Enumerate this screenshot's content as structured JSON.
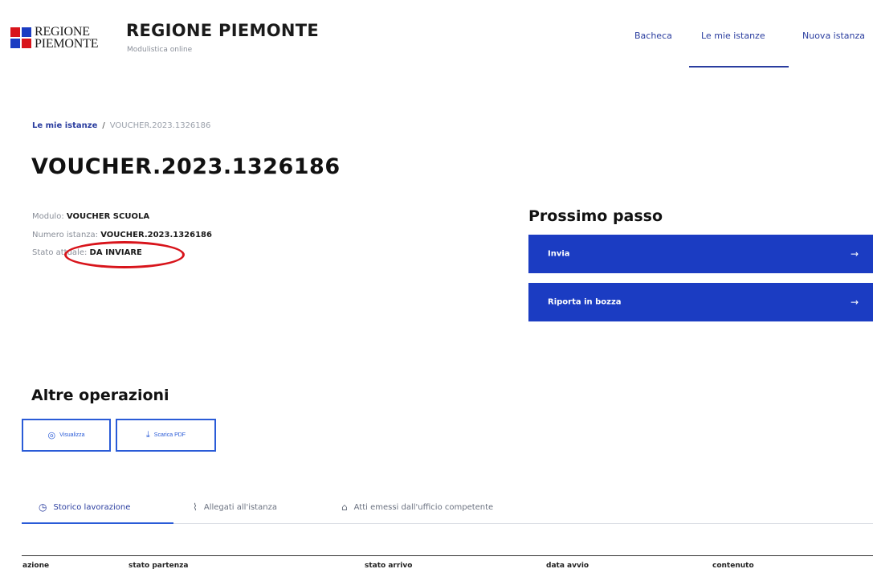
{
  "header": {
    "logo_line1": "REGIONE",
    "logo_line2": "PIEMONTE",
    "title": "REGIONE PIEMONTE",
    "subtitle": "Modulistica online",
    "nav": [
      {
        "label": "Bacheca"
      },
      {
        "label": "Le mie istanze"
      },
      {
        "label": "Nuova istanza"
      }
    ]
  },
  "breadcrumb": {
    "link": "Le mie istanze",
    "separator": "/",
    "current": "VOUCHER.2023.1326186"
  },
  "page_title": "VOUCHER.2023.1326186",
  "info": {
    "modulo_label": "Modulo:",
    "modulo_value": "VOUCHER SCUOLA",
    "numero_label": "Numero istanza:",
    "numero_value": "VOUCHER.2023.1326186",
    "stato_label": "Stato attuale:",
    "stato_value": "DA INVIARE"
  },
  "next_step": {
    "title": "Prossimo passo",
    "actions": [
      {
        "label": "Invia",
        "arrow": "→"
      },
      {
        "label": "Riporta in bozza",
        "arrow": "→"
      }
    ]
  },
  "operations": {
    "title": "Altre operazioni",
    "buttons": [
      {
        "label": "Visualizza",
        "icon": "eye-icon",
        "glyph": "◎"
      },
      {
        "label": "Scarica PDF",
        "icon": "download-icon",
        "glyph": "⤓"
      }
    ]
  },
  "tabs": [
    {
      "label": "Storico lavorazione",
      "icon": "clock-icon",
      "glyph": "◷",
      "active": true
    },
    {
      "label": "Allegati all'istanza",
      "icon": "paperclip-icon",
      "glyph": "⌇",
      "active": false
    },
    {
      "label": "Atti emessi dall'ufficio competente",
      "icon": "building-icon",
      "glyph": "⌂",
      "active": false
    }
  ],
  "table": {
    "columns": [
      "azione",
      "stato partenza",
      "stato arrivo",
      "data avvio",
      "contenuto"
    ]
  },
  "colors": {
    "primary": "#1b3cc2",
    "link": "#2a3d9f",
    "annotation": "#d8141b",
    "logo_red": "#d8141b",
    "logo_blue": "#1b3cc2"
  }
}
